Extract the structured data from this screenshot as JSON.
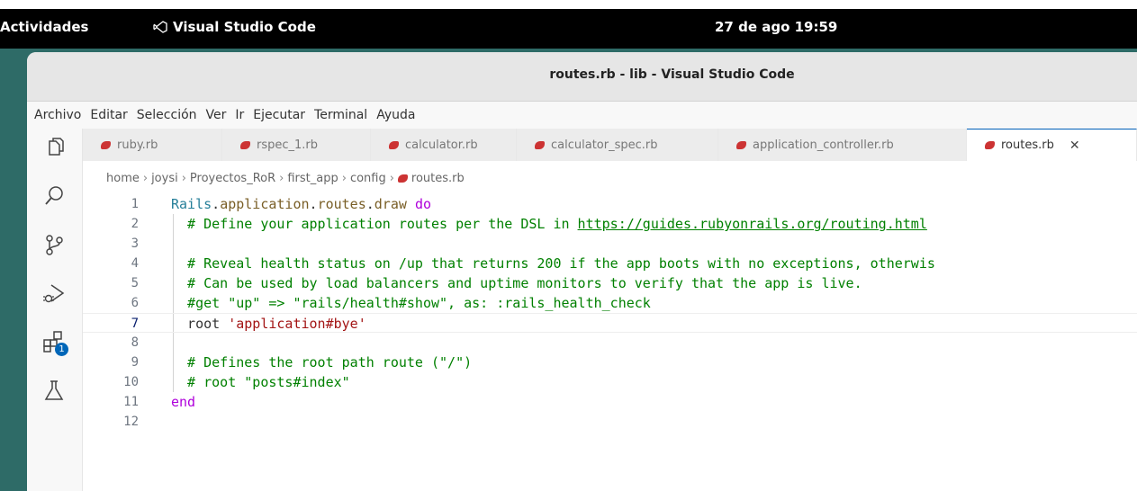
{
  "topbar": {
    "activities": "Actividades",
    "app_name": "Visual Studio Code",
    "clock": "27 de ago  19:59"
  },
  "window": {
    "title": "routes.rb - lib - Visual Studio Code"
  },
  "menu": [
    "Archivo",
    "Editar",
    "Selección",
    "Ver",
    "Ir",
    "Ejecutar",
    "Terminal",
    "Ayuda"
  ],
  "activity_bar": {
    "extensions_badge": "1"
  },
  "tabs": [
    {
      "label": "ruby.rb",
      "active": false
    },
    {
      "label": "rspec_1.rb",
      "active": false
    },
    {
      "label": "calculator.rb",
      "active": false
    },
    {
      "label": "calculator_spec.rb",
      "active": false
    },
    {
      "label": "application_controller.rb",
      "active": false
    },
    {
      "label": "routes.rb",
      "active": true
    }
  ],
  "breadcrumb": [
    "home",
    "joysi",
    "Proyectos_RoR",
    "first_app",
    "config",
    "routes.rb"
  ],
  "editor": {
    "current_line": 7,
    "lines": [
      {
        "n": "1",
        "seg": [
          [
            "c-const",
            "Rails"
          ],
          [
            "c-plain",
            "."
          ],
          [
            "c-fn",
            "application"
          ],
          [
            "c-plain",
            "."
          ],
          [
            "c-fn",
            "routes"
          ],
          [
            "c-plain",
            "."
          ],
          [
            "c-fn",
            "draw"
          ],
          [
            "c-plain",
            " "
          ],
          [
            "c-kw",
            "do"
          ]
        ]
      },
      {
        "n": "2",
        "seg": [
          [
            "c-cm",
            "  # Define your application routes per the DSL in "
          ],
          [
            "c-link",
            "https://guides.rubyonrails.org/routing.html"
          ]
        ]
      },
      {
        "n": "3",
        "seg": []
      },
      {
        "n": "4",
        "seg": [
          [
            "c-cm",
            "  # Reveal health status on /up that returns 200 if the app boots with no exceptions, otherwis"
          ]
        ]
      },
      {
        "n": "5",
        "seg": [
          [
            "c-cm",
            "  # Can be used by load balancers and uptime monitors to verify that the app is live."
          ]
        ]
      },
      {
        "n": "6",
        "seg": [
          [
            "c-cm",
            "  #get \"up\" => \"rails/health#show\", as: :rails_health_check"
          ]
        ]
      },
      {
        "n": "7",
        "seg": [
          [
            "c-plain",
            "  root "
          ],
          [
            "c-str",
            "'application#bye'"
          ]
        ]
      },
      {
        "n": "8",
        "seg": []
      },
      {
        "n": "9",
        "seg": [
          [
            "c-cm",
            "  # Defines the root path route (\"/\")"
          ]
        ]
      },
      {
        "n": "10",
        "seg": [
          [
            "c-cm",
            "  # root \"posts#index\""
          ]
        ]
      },
      {
        "n": "11",
        "seg": [
          [
            "c-kw",
            "end"
          ]
        ]
      },
      {
        "n": "12",
        "seg": []
      }
    ]
  }
}
